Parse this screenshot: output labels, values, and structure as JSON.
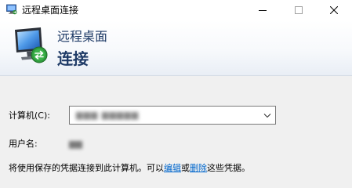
{
  "window": {
    "title": "远程桌面连接"
  },
  "title_bar_buttons": {
    "minimize_icon": "minimize-icon",
    "maximize_icon": "maximize-icon",
    "close_icon": "close-icon"
  },
  "header": {
    "subtitle": "远程桌面",
    "title": "连接",
    "icon": "remote-desktop-icon"
  },
  "form": {
    "computer_label": "计算机(C):",
    "computer_value": "▆▆▆ ▆▆▆▆▆",
    "username_label": "用户名:",
    "username_value": "▆▆"
  },
  "info": {
    "prefix": "将使用保存的凭据连接到此计算机。可以",
    "edit_link": "编辑",
    "middle": "或",
    "delete_link": "删除",
    "suffix": "这些凭据。"
  },
  "colors": {
    "header_text": "#1e3a66",
    "link": "#0066cc",
    "background": "#f0f0f0"
  }
}
